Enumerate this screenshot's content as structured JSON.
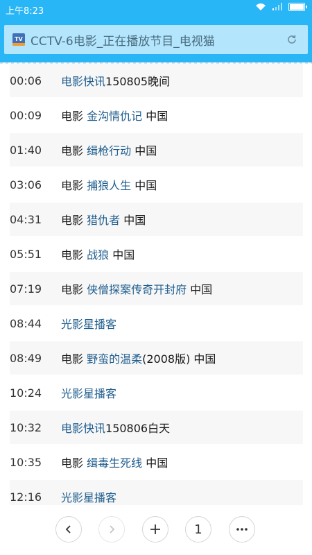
{
  "status_bar": {
    "time": "上午8:23"
  },
  "address_bar": {
    "title": "CCTV-6电影_正在播放节目_电视猫",
    "tv_icon_text": "TV"
  },
  "schedule": [
    {
      "time": "00:06",
      "prefix": "",
      "link": "电影快讯",
      "suffix": "150805晚间"
    },
    {
      "time": "00:09",
      "prefix": "电影 ",
      "link": "金沟情仇记",
      "suffix": " 中国"
    },
    {
      "time": "01:40",
      "prefix": "电影 ",
      "link": "缉枪行动",
      "suffix": " 中国"
    },
    {
      "time": "03:06",
      "prefix": "电影 ",
      "link": "捕狼人生",
      "suffix": " 中国"
    },
    {
      "time": "04:31",
      "prefix": "电影 ",
      "link": "猎仇者",
      "suffix": " 中国"
    },
    {
      "time": "05:51",
      "prefix": "电影 ",
      "link": "战狼",
      "suffix": " 中国"
    },
    {
      "time": "07:19",
      "prefix": "电影 ",
      "link": "侠僧探案传奇开封府",
      "suffix": " 中国"
    },
    {
      "time": "08:44",
      "prefix": "",
      "link": "光影星播客",
      "suffix": ""
    },
    {
      "time": "08:49",
      "prefix": "电影 ",
      "link": "野蛮的温柔",
      "suffix": "(2008版) 中国"
    },
    {
      "time": "10:24",
      "prefix": "",
      "link": "光影星播客",
      "suffix": ""
    },
    {
      "time": "10:32",
      "prefix": "",
      "link": "电影快讯",
      "suffix": "150806白天"
    },
    {
      "time": "10:35",
      "prefix": "电影 ",
      "link": "缉毒生死线",
      "suffix": " 中国"
    },
    {
      "time": "12:16",
      "prefix": "",
      "link": "光影星播客",
      "suffix": ""
    }
  ],
  "bottom_nav": {
    "tab_count": "1"
  },
  "colors": {
    "accent": "#29b6f6",
    "address_bg": "#b3e5fc",
    "link": "#1f5d8e",
    "row_shade": "#f7f7f7"
  }
}
